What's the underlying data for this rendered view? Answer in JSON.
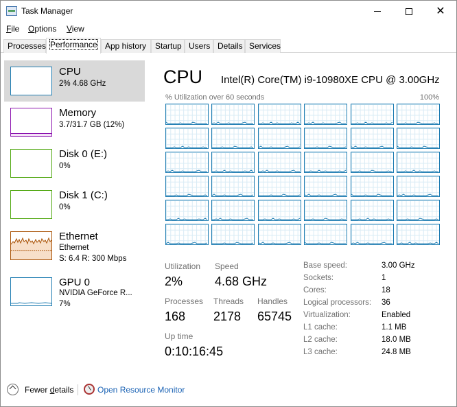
{
  "window": {
    "title": "Task Manager"
  },
  "menu": {
    "file": "File",
    "options": "Options",
    "view": "View"
  },
  "tabs": [
    "Processes",
    "Performance",
    "App history",
    "Startup",
    "Users",
    "Details",
    "Services"
  ],
  "sidebar": [
    {
      "title": "CPU",
      "line1": "2% 4.68 GHz",
      "line2": "",
      "color": "#1c7bb1"
    },
    {
      "title": "Memory",
      "line1": "3.7/31.7 GB (12%)",
      "line2": "",
      "color": "#8b12ae"
    },
    {
      "title": "Disk 0 (E:)",
      "line1": "0%",
      "line2": "",
      "color": "#4da60c"
    },
    {
      "title": "Disk 1 (C:)",
      "line1": "0%",
      "line2": "",
      "color": "#4da60c"
    },
    {
      "title": "Ethernet",
      "line1": "Ethernet",
      "line2_s": "S: 6.4 R: 300 Mbps",
      "color": "#a74f01"
    },
    {
      "title": "GPU 0",
      "line1": "NVIDIA GeForce R...",
      "line2": "7%",
      "color": "#1c7bb1"
    }
  ],
  "main": {
    "title": "CPU",
    "model": "Intel(R) Core(TM) i9-10980XE CPU @ 3.00GHz",
    "util_label": "% Utilization over 60 seconds",
    "util_max": "100%"
  },
  "stats": {
    "utilization_label": "Utilization",
    "utilization": "2%",
    "speed_label": "Speed",
    "speed": "4.68 GHz",
    "processes_label": "Processes",
    "processes": "168",
    "threads_label": "Threads",
    "threads": "2178",
    "handles_label": "Handles",
    "handles": "65745",
    "uptime_label": "Up time",
    "uptime": "0:10:16:45"
  },
  "specs": [
    {
      "label": "Base speed:",
      "value": "3.00 GHz"
    },
    {
      "label": "Sockets:",
      "value": "1"
    },
    {
      "label": "Cores:",
      "value": "18"
    },
    {
      "label": "Logical processors:",
      "value": "36"
    },
    {
      "label": "Virtualization:",
      "value": "Enabled"
    },
    {
      "label": "L1 cache:",
      "value": "1.1 MB"
    },
    {
      "label": "L2 cache:",
      "value": "18.0 MB"
    },
    {
      "label": "L3 cache:",
      "value": "24.8 MB"
    }
  ],
  "footer": {
    "fewer_details": "Fewer details",
    "open_resource_monitor": "Open Resource Monitor"
  },
  "colors": {
    "cpu": "#1c7bb1",
    "memory": "#8b12ae",
    "disk": "#4da60c",
    "ethernet": "#a74f01",
    "link": "#1a62b4"
  }
}
